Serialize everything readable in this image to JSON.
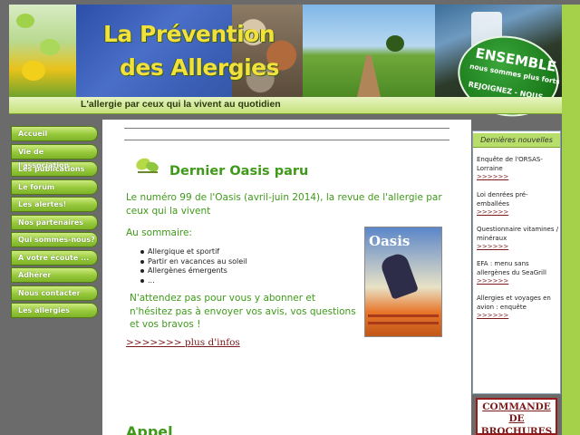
{
  "header": {
    "title_line1": "La Prévention",
    "title_line2": "des Allergies",
    "badge_big": "ENSEMBLE",
    "badge_small": "nous sommes plus forts",
    "badge_join": "REJOIGNEZ - NOUS",
    "tagline": "L'allergie par ceux qui la vivent au quotidien"
  },
  "nav": {
    "items": [
      "Accueil",
      "Vie de l'association",
      "Les publications",
      "Le forum",
      "Les alertes!",
      "Nos partenaires",
      "Qui sommes-nous?",
      "A votre écoute ...",
      "Adhérer",
      "Nous contacter",
      "Les allergies"
    ]
  },
  "main": {
    "section_title": "Dernier Oasis paru",
    "intro": "Le numéro 99 de l'Oasis (avril-juin 2014), la revue de l'allergie par ceux qui la vivent",
    "summary_label": "Au sommaire:",
    "summary_items": [
      "Allergique et sportif",
      "Partir en vacances au soleil",
      "Allergènes émergents",
      "..."
    ],
    "cta": "N'attendez pas pour vous y abonner et n'hésitez pas à envoyer vos avis, vos questions et vos bravos !",
    "more_link": ">>>>>>> plus d'infos",
    "cover_logo": "Oasis",
    "next_title": "Appel"
  },
  "sidebar": {
    "header": "Dernières nouvelles",
    "news": [
      {
        "text": "Enquête de l'ORSAS-Lorraine",
        "link": ">>>>>>"
      },
      {
        "text": "Loi denrées pré-emballées",
        "link": ">>>>>>"
      },
      {
        "text": "Questionnaire vitamines / minéraux",
        "link": ">>>>>>"
      },
      {
        "text": "EFA : menu sans allergènes du SeaGrill",
        "link": ">>>>>>"
      },
      {
        "text": "Allergies et voyages en avion : enquête",
        "link": ">>>>>>"
      }
    ],
    "brochures_line1": "COMMANDE DE",
    "brochures_line2": "BROCHURES"
  },
  "colors": {
    "accent_green": "#3f9a1a",
    "nav_green": "#95c83a",
    "link_red": "#7a1a1a",
    "background": "#6b6b6b"
  }
}
